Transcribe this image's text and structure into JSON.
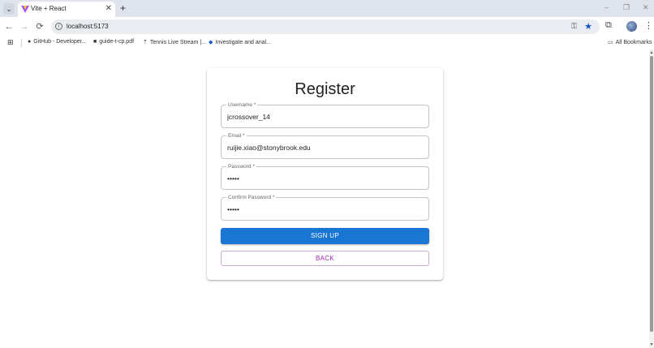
{
  "browser": {
    "tab": {
      "title": "Vite + React",
      "close": "✕"
    },
    "new_tab": "+",
    "window_controls": {
      "minimize": "–",
      "restore": "❐",
      "close": "✕"
    },
    "nav": {
      "back": "←",
      "forward": "→",
      "reload": "⟳"
    },
    "url": "localhost:5173",
    "bookmarks": [
      {
        "icon": "github-icon",
        "label": "GitHub - Developer..."
      },
      {
        "icon": "pdf-icon",
        "label": "guide-t-cp.pdf"
      },
      {
        "icon": "upload-icon",
        "label": "Tennis Live Stream |..."
      },
      {
        "icon": "gem-icon",
        "label": "Investigate and anal..."
      }
    ],
    "all_bookmarks": "All Bookmarks"
  },
  "form": {
    "title": "Register",
    "fields": [
      {
        "label": "Username *",
        "value": "jcrossover_14"
      },
      {
        "label": "Email *",
        "value": "ruijie.xiao@stonybrook.edu"
      },
      {
        "label": "Password *",
        "value": "•••••"
      },
      {
        "label": "Confirm Password *",
        "value": "•••••"
      }
    ],
    "signup_label": "SIGN UP",
    "back_label": "BACK"
  },
  "colors": {
    "primary": "#1976d2",
    "secondary": "#9c27b0"
  }
}
